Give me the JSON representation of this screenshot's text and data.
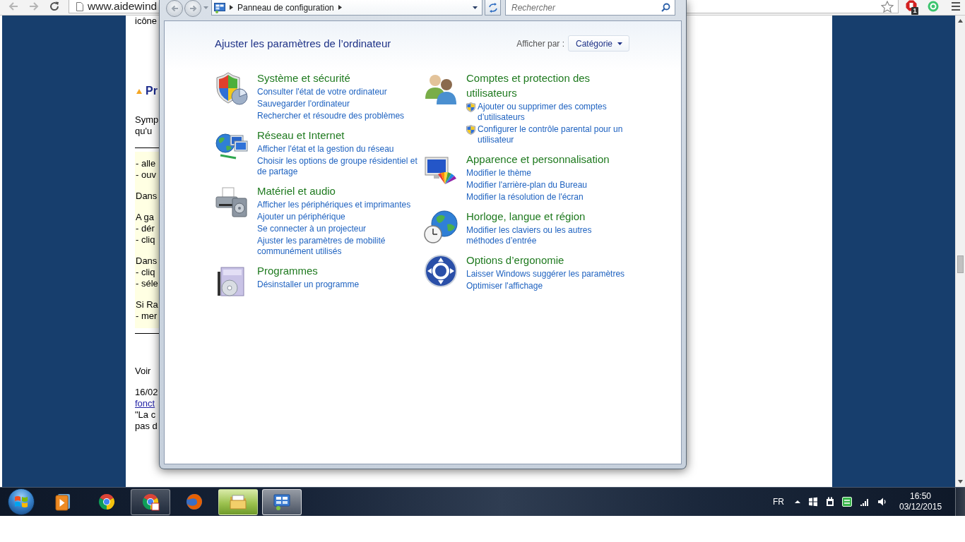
{
  "browser": {
    "address": "www.aidewind",
    "extension_badge": "1"
  },
  "page": {
    "blocks": [
      {
        "kind": "paragraph",
        "lines": [
          {
            "text": "icône",
            "link": false
          }
        ]
      },
      {
        "kind": "heading",
        "text": "Pr"
      },
      {
        "kind": "paragraph",
        "lines": [
          {
            "text": "Symp",
            "link": false
          },
          {
            "text": "qu'u",
            "link": false
          }
        ]
      },
      {
        "kind": "rule"
      },
      {
        "kind": "note",
        "blocks": [
          {
            "kind": "paragraph",
            "lines": [
              {
                "text": "- alle",
                "link": false
              },
              {
                "text": "- ouv",
                "link": false
              }
            ]
          },
          {
            "kind": "paragraph",
            "lines": [
              {
                "text": "Dans",
                "link": false
              }
            ]
          },
          {
            "kind": "paragraph",
            "lines": [
              {
                "text": "A ga",
                "link": false
              },
              {
                "text": "- dér",
                "link": false
              },
              {
                "text": "- cliq",
                "link": false
              }
            ]
          },
          {
            "kind": "paragraph",
            "lines": [
              {
                "text": "Dans",
                "link": false
              },
              {
                "text": "- cliq",
                "link": false
              },
              {
                "text": "- séle",
                "link": false
              }
            ]
          },
          {
            "kind": "paragraph",
            "lines": [
              {
                "text": "Si Ra",
                "link": false
              },
              {
                "text": "- mer",
                "link": false
              }
            ]
          }
        ]
      },
      {
        "kind": "rule"
      },
      {
        "kind": "paragraph",
        "lines": [
          {
            "text": "Voir",
            "link": false
          }
        ]
      },
      {
        "kind": "paragraph",
        "lines": [
          {
            "text": "16/02",
            "link": false
          },
          {
            "text": "fonct",
            "link": true
          },
          {
            "text": "\"La c",
            "link": false
          },
          {
            "text": "pas d",
            "link": false
          }
        ]
      }
    ]
  },
  "control_panel": {
    "nav": {
      "back": {
        "disabled": true
      },
      "forward": {
        "disabled": true
      }
    },
    "breadcrumb": [
      "Panneau de configuration"
    ],
    "search": {
      "placeholder": "Rechercher"
    },
    "heading": "Ajuster les paramètres de l’ordinateur",
    "view_by": {
      "label": "Afficher par :",
      "value": "Catégorie"
    },
    "columns": [
      [
        {
          "kind": "security",
          "title": "Système et sécurité",
          "links": [
            {
              "text": "Consulter l'état de votre ordinateur",
              "shield": false
            },
            {
              "text": "Sauvegarder l'ordinateur",
              "shield": false
            },
            {
              "text": "Rechercher et résoudre des problèmes",
              "shield": false
            }
          ]
        },
        {
          "kind": "network",
          "title": "Réseau et Internet",
          "links": [
            {
              "text": "Afficher l'état et la gestion du réseau",
              "shield": false
            },
            {
              "text": "Choisir les options de groupe résidentiel et de partage",
              "shield": false
            }
          ]
        },
        {
          "kind": "hardware",
          "title": "Matériel et audio",
          "links": [
            {
              "text": "Afficher les périphériques et imprimantes",
              "shield": false
            },
            {
              "text": "Ajouter un périphérique",
              "shield": false
            },
            {
              "text": "Se connecter à un projecteur",
              "shield": false
            },
            {
              "text": "Ajuster les paramètres de mobilité communément utilisés",
              "shield": false
            }
          ]
        },
        {
          "kind": "programs",
          "title": "Programmes",
          "links": [
            {
              "text": "Désinstaller un programme",
              "shield": false
            }
          ]
        }
      ],
      [
        {
          "kind": "accounts",
          "title": "Comptes et protection des utilisateurs",
          "links": [
            {
              "text": "Ajouter ou supprimer des comptes d’utilisateurs",
              "shield": true
            },
            {
              "text": "Configurer le contrôle parental pour un utilisateur",
              "shield": true
            }
          ]
        },
        {
          "kind": "appearance",
          "title": "Apparence et personnalisation",
          "links": [
            {
              "text": "Modifier le thème",
              "shield": false
            },
            {
              "text": "Modifier l'arrière-plan du Bureau",
              "shield": false
            },
            {
              "text": "Modifier la résolution de l'écran",
              "shield": false
            }
          ]
        },
        {
          "kind": "clock",
          "title": "Horloge, langue et région",
          "links": [
            {
              "text": "Modifier les claviers ou les autres méthodes d’entrée",
              "shield": false
            }
          ]
        },
        {
          "kind": "access",
          "title": "Options d’ergonomie",
          "links": [
            {
              "text": "Laisser Windows suggérer les paramètres",
              "shield": false
            },
            {
              "text": "Optimiser l'affichage",
              "shield": false
            }
          ]
        }
      ]
    ]
  },
  "taskbar": {
    "apps": [
      {
        "kind": "media",
        "running": false,
        "selected": false,
        "hovered": false
      },
      {
        "kind": "chrome",
        "running": false,
        "selected": false,
        "hovered": false
      },
      {
        "kind": "chrome-page",
        "running": true,
        "selected": false,
        "hovered": false
      },
      {
        "kind": "firefox",
        "running": false,
        "selected": false,
        "hovered": false
      },
      {
        "kind": "explorer",
        "running": true,
        "selected": false,
        "hovered": true
      },
      {
        "kind": "control-panel",
        "running": true,
        "selected": true,
        "hovered": false
      }
    ],
    "language": "FR",
    "time": "16:50",
    "date": "03/12/2015"
  }
}
